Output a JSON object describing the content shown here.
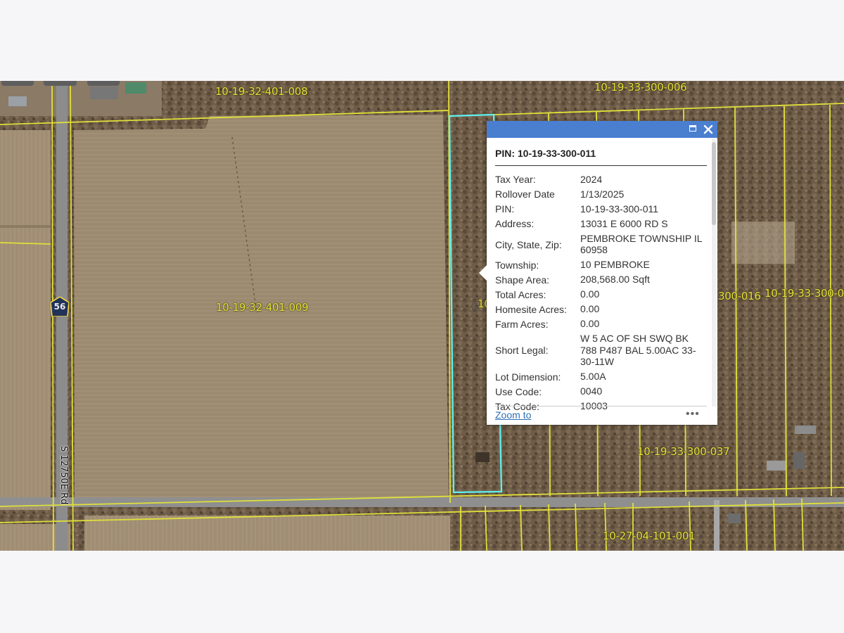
{
  "map": {
    "parcel_labels": [
      "10-19-32-401-008",
      "10-19-33-300-006",
      "10-19-32-401-009",
      "10",
      "300-016",
      "10-19-33-300-0",
      "10-19-33-300-037",
      "10-27-04-101-001"
    ],
    "road_label": "S 12750E Rd",
    "route_shield": "56",
    "colors": {
      "parcel_line": "#e0e03a",
      "selected_parcel": "#5ff2f2",
      "popup_header": "#4a7fd0",
      "link": "#2f6fb5"
    }
  },
  "popup": {
    "title": "PIN: 10-19-33-300-011",
    "header_icons": [
      "maximize-icon",
      "close-icon"
    ],
    "fields": [
      {
        "key": "Tax Year:",
        "value": "2024"
      },
      {
        "key": "Rollover Date",
        "value": "1/13/2025"
      },
      {
        "key": "PIN:",
        "value": "10-19-33-300-011"
      },
      {
        "key": "Address:",
        "value": "13031 E 6000 RD S"
      },
      {
        "key": "City, State, Zip:",
        "value": "PEMBROKE TOWNSHIP IL 60958"
      },
      {
        "key": "Township:",
        "value": "10  PEMBROKE"
      },
      {
        "key": "Shape Area:",
        "value": "208,568.00 Sqft"
      },
      {
        "key": "Total Acres:",
        "value": "0.00"
      },
      {
        "key": "Homesite Acres:",
        "value": "0.00"
      },
      {
        "key": "Farm Acres:",
        "value": "0.00"
      },
      {
        "key": "Short Legal:",
        "value": "W 5 AC OF SH SWQ BK 788 P487 BAL 5.00AC 33-30-11W"
      },
      {
        "key": "Lot Dimension:",
        "value": "5.00A"
      },
      {
        "key": "Use Code:",
        "value": "0040"
      },
      {
        "key": "Tax Code:",
        "value": "10003"
      }
    ],
    "zoom_link": "Zoom to",
    "more_icon": "•••"
  }
}
